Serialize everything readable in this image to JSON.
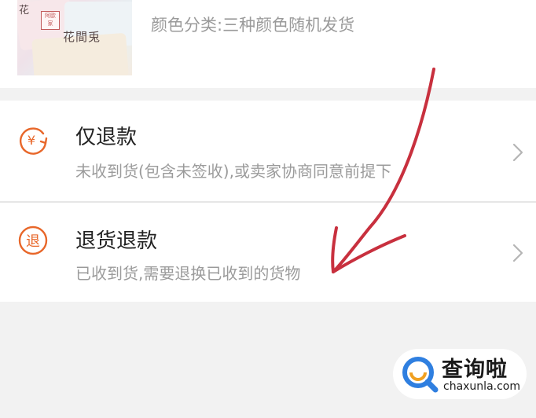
{
  "product": {
    "thumbnail_brand": "花間兎",
    "thumbnail_brand_short": "花",
    "thumbnail_tag": "阿歐 家",
    "color_classification": "颜色分类:三种颜色随机发货"
  },
  "refund_options": [
    {
      "icon": "yen-refund-icon",
      "icon_glyph": "¥",
      "title": "仅退款",
      "subtitle": "未收到货(包含未签收),或卖家协商同意前提下"
    },
    {
      "icon": "return-refund-icon",
      "icon_glyph": "退",
      "title": "退货退款",
      "subtitle": "已收到货,需要退换已收到的货物"
    }
  ],
  "watermark": {
    "title": "查询啦",
    "domain": "chaxunla.com"
  },
  "colors": {
    "accent_orange": "#e8672a",
    "annotation_red": "#c8303e",
    "text_primary": "#222222",
    "text_secondary": "#9b9b9b",
    "page_bg": "#f2f2f2",
    "watermark_blue": "#2f7fe0"
  }
}
